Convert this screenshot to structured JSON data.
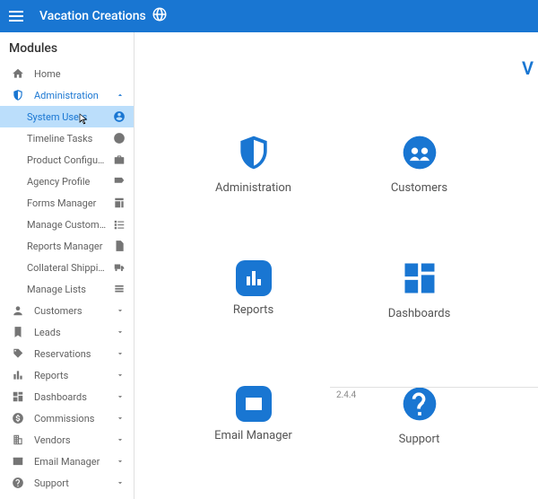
{
  "topbar": {
    "title": "Vacation Creations"
  },
  "sidebar": {
    "header": "Modules",
    "items": [
      {
        "label": "Home",
        "icon": "home"
      },
      {
        "label": "Administration",
        "icon": "shield",
        "expanded": true,
        "children": [
          {
            "label": "System Users",
            "icon": "user-circle",
            "active": true
          },
          {
            "label": "Timeline Tasks",
            "icon": "clock"
          },
          {
            "label": "Product Configuration",
            "icon": "briefcase"
          },
          {
            "label": "Agency Profile",
            "icon": "tag"
          },
          {
            "label": "Forms Manager",
            "icon": "form"
          },
          {
            "label": "Manage Customer T…",
            "icon": "list-check"
          },
          {
            "label": "Reports Manager",
            "icon": "doc"
          },
          {
            "label": "Collateral Shipping",
            "icon": "truck"
          },
          {
            "label": "Manage Lists",
            "icon": "list"
          }
        ]
      },
      {
        "label": "Customers",
        "icon": "people"
      },
      {
        "label": "Leads",
        "icon": "bookmark"
      },
      {
        "label": "Reservations",
        "icon": "pricetag"
      },
      {
        "label": "Reports",
        "icon": "bar-chart"
      },
      {
        "label": "Dashboards",
        "icon": "dashboard"
      },
      {
        "label": "Commissions",
        "icon": "money"
      },
      {
        "label": "Vendors",
        "icon": "building"
      },
      {
        "label": "Email Manager",
        "icon": "mail"
      },
      {
        "label": "Support",
        "icon": "help"
      }
    ]
  },
  "main": {
    "welcome": "V",
    "cards": [
      {
        "label": "Administration",
        "icon": "shield"
      },
      {
        "label": "Customers",
        "icon": "people-circle"
      },
      {
        "label": "Reports",
        "icon": "bar-chart-box"
      },
      {
        "label": "Dashboards",
        "icon": "dashboard-big"
      },
      {
        "label": "Email Manager",
        "icon": "mail-big"
      },
      {
        "label": "Support",
        "icon": "help-circle"
      }
    ],
    "version": "2.4.4"
  }
}
